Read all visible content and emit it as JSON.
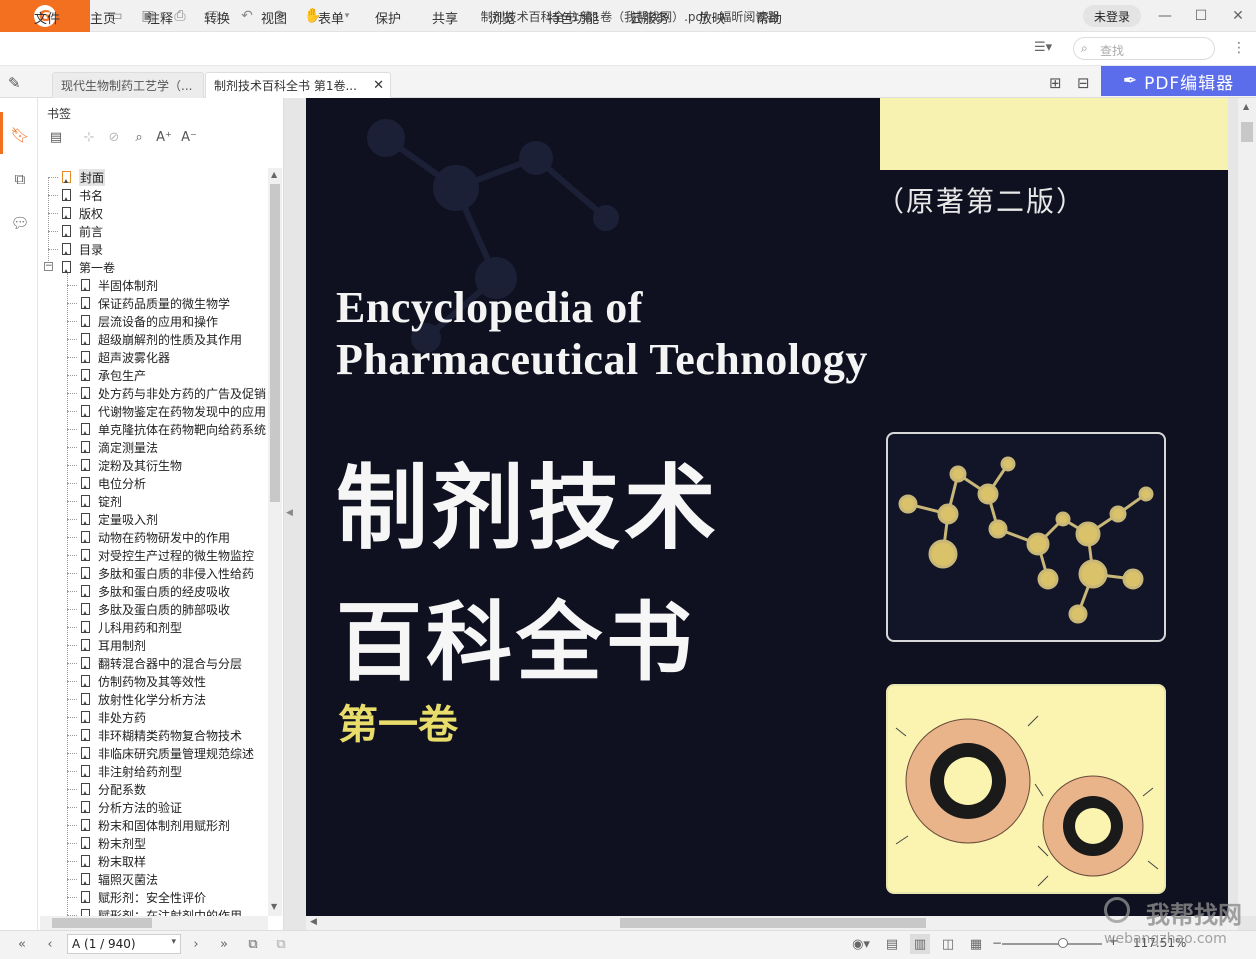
{
  "app": {
    "title": "制剂技术百科全书 第1卷（我帮找网）.pdf - 福昕阅读器",
    "login_label": "未登录",
    "brand_color": "#f37021"
  },
  "quick_access_icons": [
    "open-folder-icon",
    "save-icon",
    "print-icon",
    "new-doc-icon",
    "undo-icon",
    "redo-icon",
    "hand-tool-icon",
    "customize-dropdown-icon"
  ],
  "menu": {
    "items": [
      "文件",
      "主页",
      "注释",
      "转换",
      "视图",
      "表单",
      "保护",
      "共享",
      "浏览",
      "特色功能",
      "云服务",
      "放映",
      "帮助"
    ],
    "search_placeholder": "查找"
  },
  "tabs": [
    {
      "label": "现代生物制药工艺学（...",
      "active": false
    },
    {
      "label": "制剂技术百科全书 第1卷...",
      "active": true
    }
  ],
  "pdf_editor_label": "PDF编辑器",
  "bookmark_panel": {
    "title": "书签",
    "top_items": [
      "封面",
      "书名",
      "版权",
      "前言",
      "目录",
      "第一卷"
    ],
    "selected": "封面",
    "volume_children": [
      "半固体制剂",
      "保证药品质量的微生物学",
      "层流设备的应用和操作",
      "超级崩解剂的性质及其作用",
      "超声波雾化器",
      "承包生产",
      "处方药与非处方药的广告及促销",
      "代谢物鉴定在药物发现中的应用",
      "单克隆抗体在药物靶向给药系统",
      "滴定测量法",
      "淀粉及其衍生物",
      "电位分析",
      "锭剂",
      "定量吸入剂",
      "动物在药物研发中的作用",
      "对受控生产过程的微生物监控",
      "多肽和蛋白质的非侵入性给药",
      "多肽和蛋白质的经皮吸收",
      "多肽及蛋白质的肺部吸收",
      "儿科用药和剂型",
      "耳用制剂",
      "翻转混合器中的混合与分层",
      "仿制药物及其等效性",
      "放射性化学分析方法",
      "非处方药",
      "非环糊精类药物复合物技术",
      "非临床研究质量管理规范综述",
      "非注射给药剂型",
      "分配系数",
      "分析方法的验证",
      "粉末和固体制剂用赋形剂",
      "粉末剂型",
      "粉末取样",
      "辐照灭菌法",
      "赋形剂：安全性评价",
      "赋形剂：在注射剂中的作用"
    ]
  },
  "cover": {
    "edition": "（原著第二版）",
    "title_en_line1": "Encyclopedia of",
    "title_en_line2": "Pharmaceutical Technology",
    "title_zh_line1": "制剂技术",
    "title_zh_line2": "百科全书",
    "volume": "第一卷",
    "background_color": "#0f1120",
    "accent_yellow": "#f8f2b0",
    "volume_color": "#e8dc6a"
  },
  "status_bar": {
    "page_indicator": "A (1 / 940)",
    "zoom": "117.51%"
  },
  "watermark": {
    "text_zh": "我帮找网",
    "text_url": "webangzhao.com"
  }
}
